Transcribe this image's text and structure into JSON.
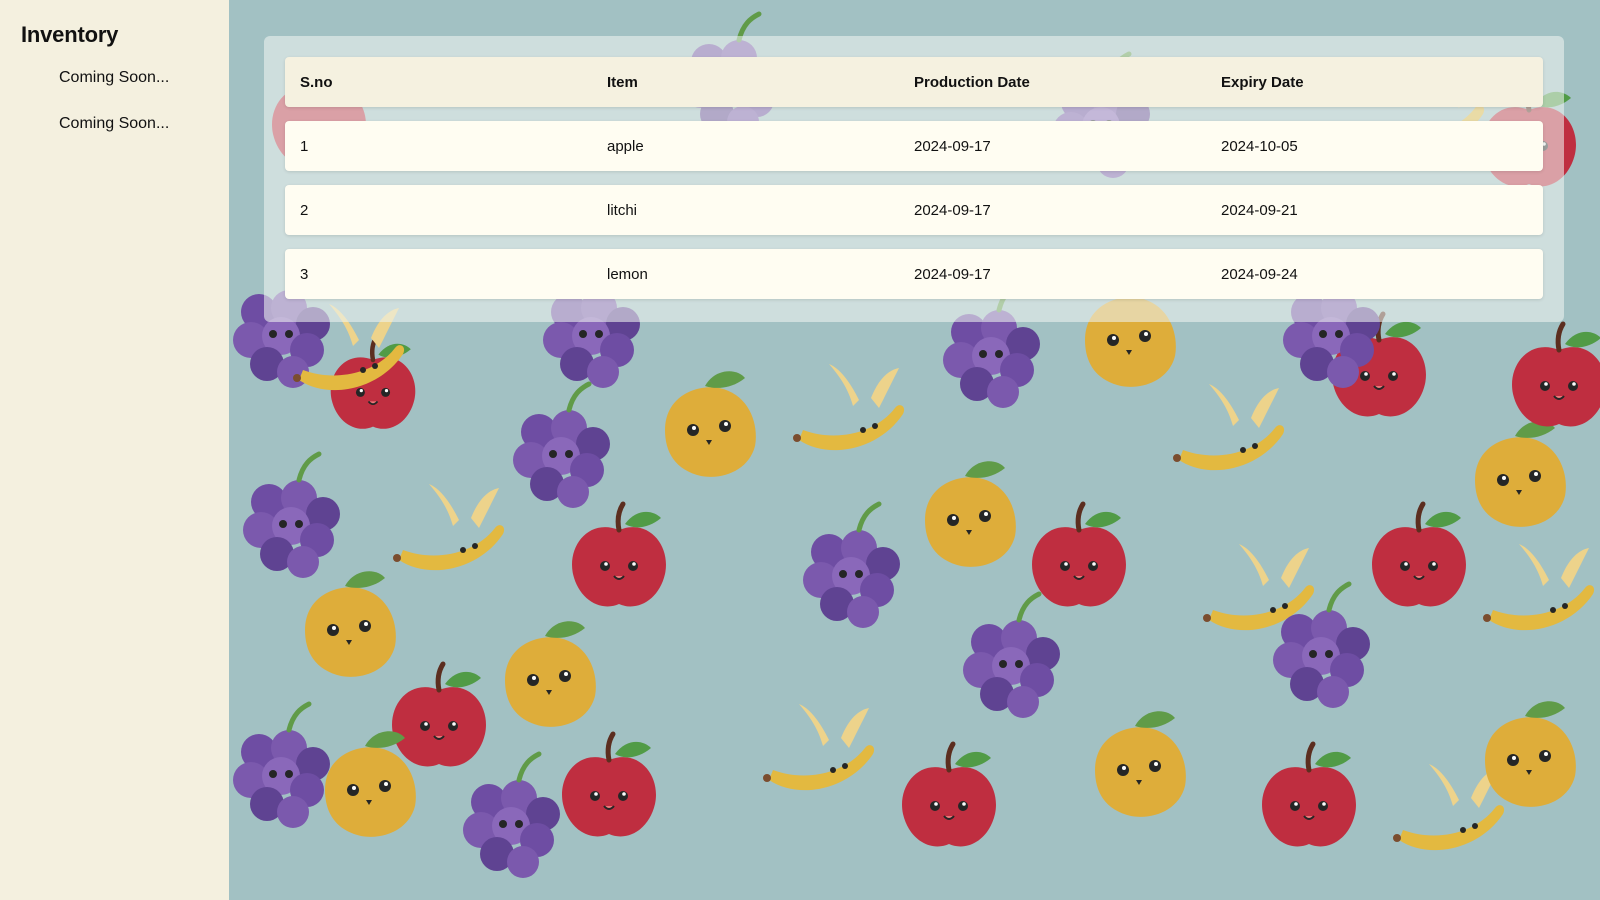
{
  "sidebar": {
    "title": "Inventory",
    "items": [
      {
        "label": "Coming Soon..."
      },
      {
        "label": "Coming Soon..."
      }
    ]
  },
  "table": {
    "columns": [
      "S.no",
      "Item",
      "Production Date",
      "Expiry Date"
    ],
    "rows": [
      [
        "1",
        "apple",
        "2024-09-17",
        "2024-10-05"
      ],
      [
        "2",
        "litchi",
        "2024-09-17",
        "2024-09-21"
      ],
      [
        "3",
        "lemon",
        "2024-09-17",
        "2024-09-24"
      ]
    ]
  },
  "colors": {
    "sidebar_bg": "#f4f0df",
    "main_bg": "#a2c1c3",
    "header_row_bg": "#f5f1e0",
    "row_bg": "#fffdf2"
  },
  "background_pattern": "fruit-pattern-illustration"
}
